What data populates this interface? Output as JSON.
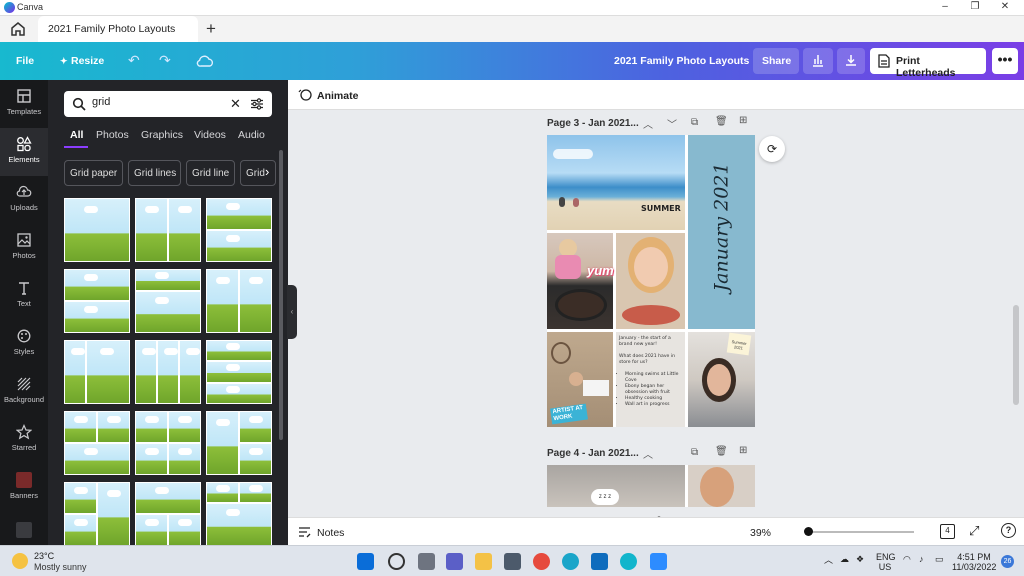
{
  "window": {
    "app_name": "Canva",
    "min": "–",
    "max": "❐",
    "close": "✕"
  },
  "tabs": [
    {
      "label": "2021 Family Photo Layouts"
    }
  ],
  "toolbar": {
    "file": "File",
    "resize": "Resize",
    "doc_title": "2021 Family Photo Layouts",
    "share": "Share",
    "print": "Print Letterheads",
    "more": "•••"
  },
  "nav": [
    {
      "label": "Templates",
      "icon": "templates-icon"
    },
    {
      "label": "Elements",
      "icon": "elements-icon",
      "active": true
    },
    {
      "label": "Uploads",
      "icon": "uploads-icon"
    },
    {
      "label": "Photos",
      "icon": "photos-icon"
    },
    {
      "label": "Text",
      "icon": "text-icon"
    },
    {
      "label": "Styles",
      "icon": "styles-icon"
    },
    {
      "label": "Background",
      "icon": "background-icon"
    },
    {
      "label": "Starred",
      "icon": "star-icon"
    },
    {
      "label": "Banners",
      "icon": "banners-icon"
    }
  ],
  "panel": {
    "search_value": "grid",
    "categories": [
      "All",
      "Photos",
      "Graphics",
      "Videos",
      "Audio"
    ],
    "chips": [
      "Grid paper",
      "Grid lines",
      "Grid line",
      "Grid"
    ]
  },
  "canvas": {
    "animate": "Animate",
    "page3_label": "Page 3 - Jan 2021...",
    "page4_label": "Page 4 - Jan 2021...",
    "page3": {
      "summer": "SUMMER",
      "yum": "yum",
      "vertical_title": "January 2021",
      "artist": "ARTIST AT WORK",
      "note_intro": "January - the start of a brand new year!",
      "note_question": "What does 2021 have in store for us?",
      "note_items": [
        "Morning swims at Little Cove",
        "Ebony began her obsession with fruit",
        "Healthy cooking",
        "Wall art in progress"
      ],
      "sticky_note": "Summer 2021"
    },
    "sleep_text": "z z z"
  },
  "bottom": {
    "notes": "Notes",
    "zoom": "39%",
    "page_count": "4",
    "zoom_fraction": 0.0
  },
  "taskbar": {
    "weather_temp": "23°C",
    "weather_desc": "Mostly sunny",
    "lang1": "ENG",
    "lang2": "US",
    "time": "4:51 PM",
    "date": "11/03/2022",
    "badge": "26"
  }
}
